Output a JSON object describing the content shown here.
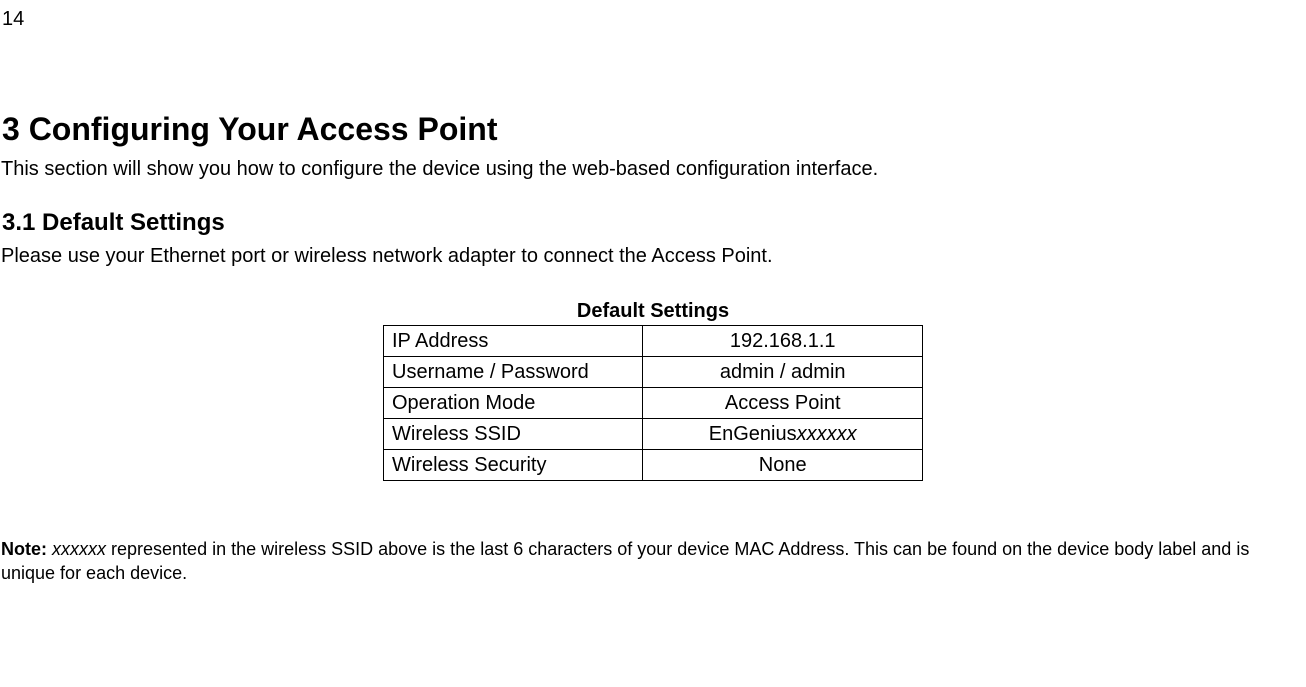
{
  "page_number": "14",
  "heading1": "3  Configuring Your Access Point",
  "intro": "This section will show you how to configure the device using the web-based configuration interface.",
  "heading2": "3.1   Default Settings",
  "subsection_text": "Please use your Ethernet port or wireless network adapter to connect the Access Point.",
  "table": {
    "title": "Default Settings",
    "rows": [
      {
        "label": "IP Address",
        "value": "192.168.1.1"
      },
      {
        "label": "Username / Password",
        "value": "admin / admin"
      },
      {
        "label": "Operation Mode",
        "value": "Access Point"
      },
      {
        "label": "Wireless SSID",
        "value_prefix": "EnGenius",
        "value_suffix": "xxxxxx"
      },
      {
        "label": "Wireless Security",
        "value": "None"
      }
    ]
  },
  "note": {
    "label": "Note:",
    "variable": "xxxxxx",
    "text": " represented in the wireless SSID above is the last 6 characters of your device MAC Address. This can be found on the device body label and is unique for each device."
  }
}
